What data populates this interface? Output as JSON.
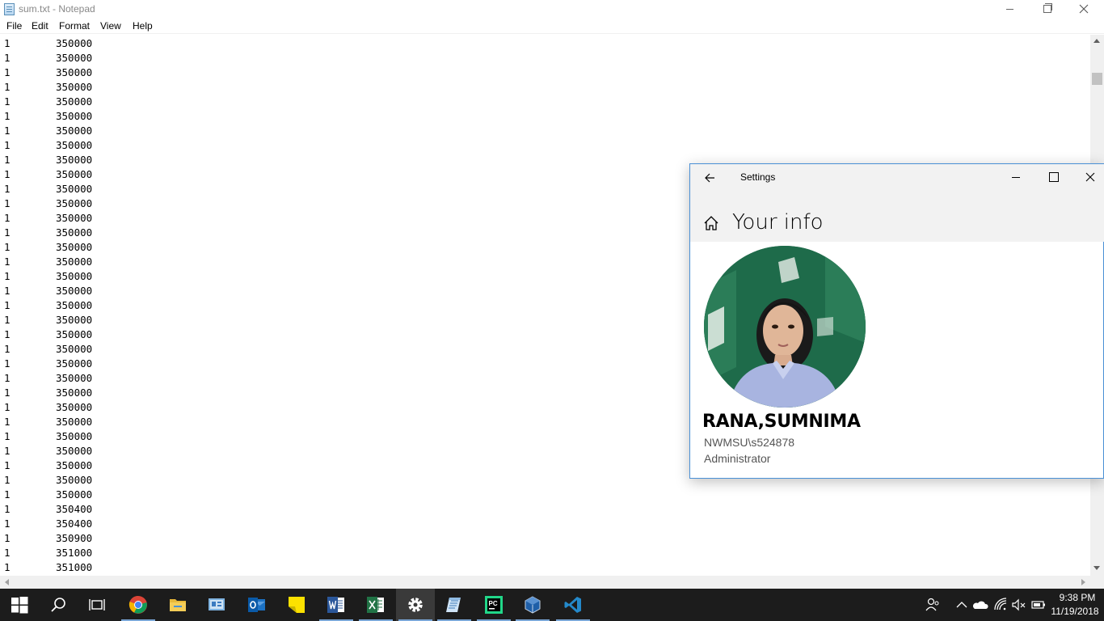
{
  "notepad": {
    "title": "sum.txt - Notepad",
    "menu": [
      "File",
      "Edit",
      "Format",
      "View",
      "Help"
    ],
    "lines": [
      [
        "1",
        "350000"
      ],
      [
        "1",
        "350000"
      ],
      [
        "1",
        "350000"
      ],
      [
        "1",
        "350000"
      ],
      [
        "1",
        "350000"
      ],
      [
        "1",
        "350000"
      ],
      [
        "1",
        "350000"
      ],
      [
        "1",
        "350000"
      ],
      [
        "1",
        "350000"
      ],
      [
        "1",
        "350000"
      ],
      [
        "1",
        "350000"
      ],
      [
        "1",
        "350000"
      ],
      [
        "1",
        "350000"
      ],
      [
        "1",
        "350000"
      ],
      [
        "1",
        "350000"
      ],
      [
        "1",
        "350000"
      ],
      [
        "1",
        "350000"
      ],
      [
        "1",
        "350000"
      ],
      [
        "1",
        "350000"
      ],
      [
        "1",
        "350000"
      ],
      [
        "1",
        "350000"
      ],
      [
        "1",
        "350000"
      ],
      [
        "1",
        "350000"
      ],
      [
        "1",
        "350000"
      ],
      [
        "1",
        "350000"
      ],
      [
        "1",
        "350000"
      ],
      [
        "1",
        "350000"
      ],
      [
        "1",
        "350000"
      ],
      [
        "1",
        "350000"
      ],
      [
        "1",
        "350000"
      ],
      [
        "1",
        "350000"
      ],
      [
        "1",
        "350000"
      ],
      [
        "1",
        "350400"
      ],
      [
        "1",
        "350400"
      ],
      [
        "1",
        "350900"
      ],
      [
        "1",
        "351000"
      ],
      [
        "1",
        "351000"
      ]
    ]
  },
  "settings": {
    "title": "Settings",
    "page_title": "Your info",
    "user_name": "RANA,SUMNIMA",
    "account": "NWMSU\\s524878",
    "role": "Administrator"
  },
  "taskbar": {
    "apps": [
      "windows-start-icon",
      "search-icon",
      "task-view-icon",
      "chrome-icon",
      "file-explorer-icon",
      "control-panel-icon",
      "outlook-icon",
      "sticky-notes-icon",
      "word-icon",
      "excel-icon",
      "settings-gear-icon",
      "notepad-icon",
      "pycharm-icon",
      "virtualbox-icon",
      "vscode-icon"
    ],
    "time": "9:38 PM",
    "date": "11/19/2018"
  },
  "colors": {
    "accent": "#4a90d6",
    "taskbar": "#1c1c1c",
    "settings_header": "#f2f2f2"
  }
}
